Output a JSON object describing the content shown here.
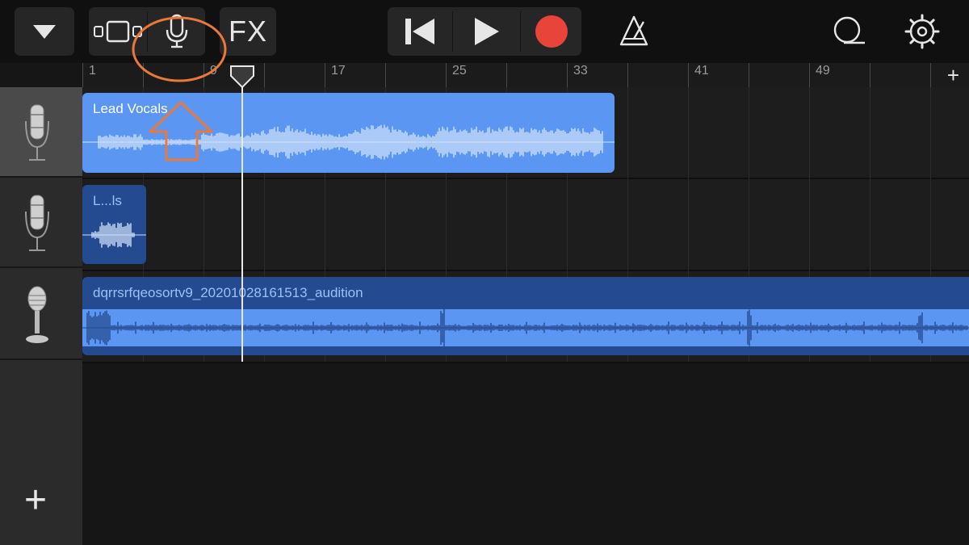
{
  "toolbar": {
    "fx_label": "FX",
    "icons": [
      "dropdown-triangle-icon",
      "tracks-view-icon",
      "microphone-icon",
      "skip-back-icon",
      "play-icon",
      "record-icon",
      "metronome-icon",
      "loop-icon",
      "settings-gear-icon"
    ]
  },
  "ruler": {
    "bar_labels": [
      "1",
      "9",
      "17",
      "25",
      "33",
      "41",
      "49"
    ],
    "add_section_label": "+"
  },
  "tracks": [
    {
      "instrument_icon": "condenser-mic-icon",
      "selected": true,
      "regions": [
        {
          "name": "Lead Vocals"
        }
      ]
    },
    {
      "instrument_icon": "condenser-mic-icon",
      "selected": false,
      "regions": [
        {
          "name": "L...ls"
        }
      ]
    },
    {
      "instrument_icon": "vintage-mic-icon",
      "selected": false,
      "regions": [
        {
          "name": "dqrrsrfqeosortv9_20201028161513_audition"
        }
      ]
    }
  ],
  "sidebar": {
    "add_track_label": "+"
  },
  "colors": {
    "region_selected": "#5b97f2",
    "region_dark": "#244a8f",
    "record": "#e8443a",
    "annotation": "#e8793a",
    "waveform_light": "#cfe0fb"
  }
}
